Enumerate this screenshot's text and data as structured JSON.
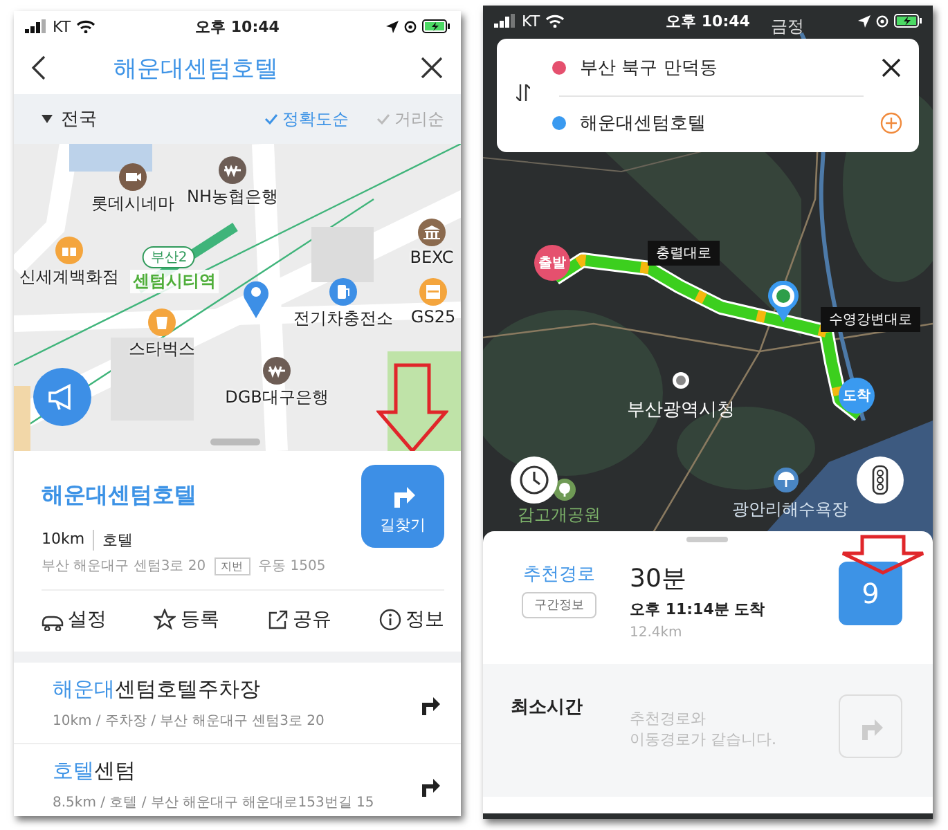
{
  "left_screen": {
    "status_bar": {
      "carrier": "KT",
      "time": "오후 10:44"
    },
    "header": {
      "title": "해운대센텀호텔"
    },
    "filter_bar": {
      "region": "전국",
      "sort_options": [
        {
          "label": "정확도순",
          "selected": true
        },
        {
          "label": "거리순",
          "selected": false
        }
      ]
    },
    "map_labels": [
      {
        "text": "롯데시네마",
        "kind": "cinema"
      },
      {
        "text": "NH농협은행",
        "kind": "bank"
      },
      {
        "text": "신세계백화점",
        "kind": "shop"
      },
      {
        "text": "센텀시티역",
        "kind": "station",
        "line": "부산2"
      },
      {
        "text": "BEXC",
        "kind": "hall"
      },
      {
        "text": "GS25",
        "kind": "store"
      },
      {
        "text": "전기차충전소",
        "kind": "charger"
      },
      {
        "text": "스타벅스",
        "kind": "cafe"
      },
      {
        "text": "DGB대구은행",
        "kind": "bank"
      }
    ],
    "place": {
      "name": "해운대센텀호텔",
      "distance": "10km",
      "category": "호텔",
      "address": "부산 해운대구 센텀3로 20",
      "address_tag": "지번",
      "postal": "우동 1505",
      "route_button": "길찾기"
    },
    "actions": [
      {
        "label": "설정",
        "kind": "car"
      },
      {
        "label": "등록",
        "kind": "star"
      },
      {
        "label": "공유",
        "kind": "share"
      },
      {
        "label": "정보",
        "kind": "info"
      }
    ],
    "results": [
      {
        "match": "해운대",
        "rest": "센텀호텔주차장",
        "detail": "10km / 주차장 / 부산 해운대구 센텀3로 20"
      },
      {
        "match": "호텔",
        "rest": "센텀",
        "detail": "8.5km / 호텔 / 부산 해운대구 해운대로153번길 15"
      }
    ]
  },
  "right_screen": {
    "status_bar": {
      "carrier": "KT",
      "time": "오후 10:44"
    },
    "route_inputs": [
      {
        "text": "부산 북구 만덕동",
        "color": "#e5506e"
      },
      {
        "text": "해운대센텀호텔",
        "color": "#3a9af0"
      }
    ],
    "map_labels": [
      {
        "text": "금정",
        "kind": "area"
      },
      {
        "text": "충렬대로",
        "kind": "road"
      },
      {
        "text": "수영강변대로",
        "kind": "road"
      },
      {
        "text": "부산광역시청",
        "kind": "landmark"
      },
      {
        "text": "감고개공원",
        "kind": "park"
      },
      {
        "text": "광안리해수욕장",
        "kind": "beach"
      }
    ],
    "markers": [
      {
        "text": "출발",
        "kind": "start"
      },
      {
        "text": "도착",
        "kind": "end"
      }
    ],
    "routes": [
      {
        "title": "추천경로",
        "section_button": "구간정보",
        "duration": "30분",
        "arrival": "오후 11:14분 도착",
        "distance": "12.4km",
        "badge": "9",
        "selected": true
      },
      {
        "title": "최소시간",
        "note": "추천경로와\n이동경로가 같습니다.",
        "selected": false
      }
    ]
  }
}
